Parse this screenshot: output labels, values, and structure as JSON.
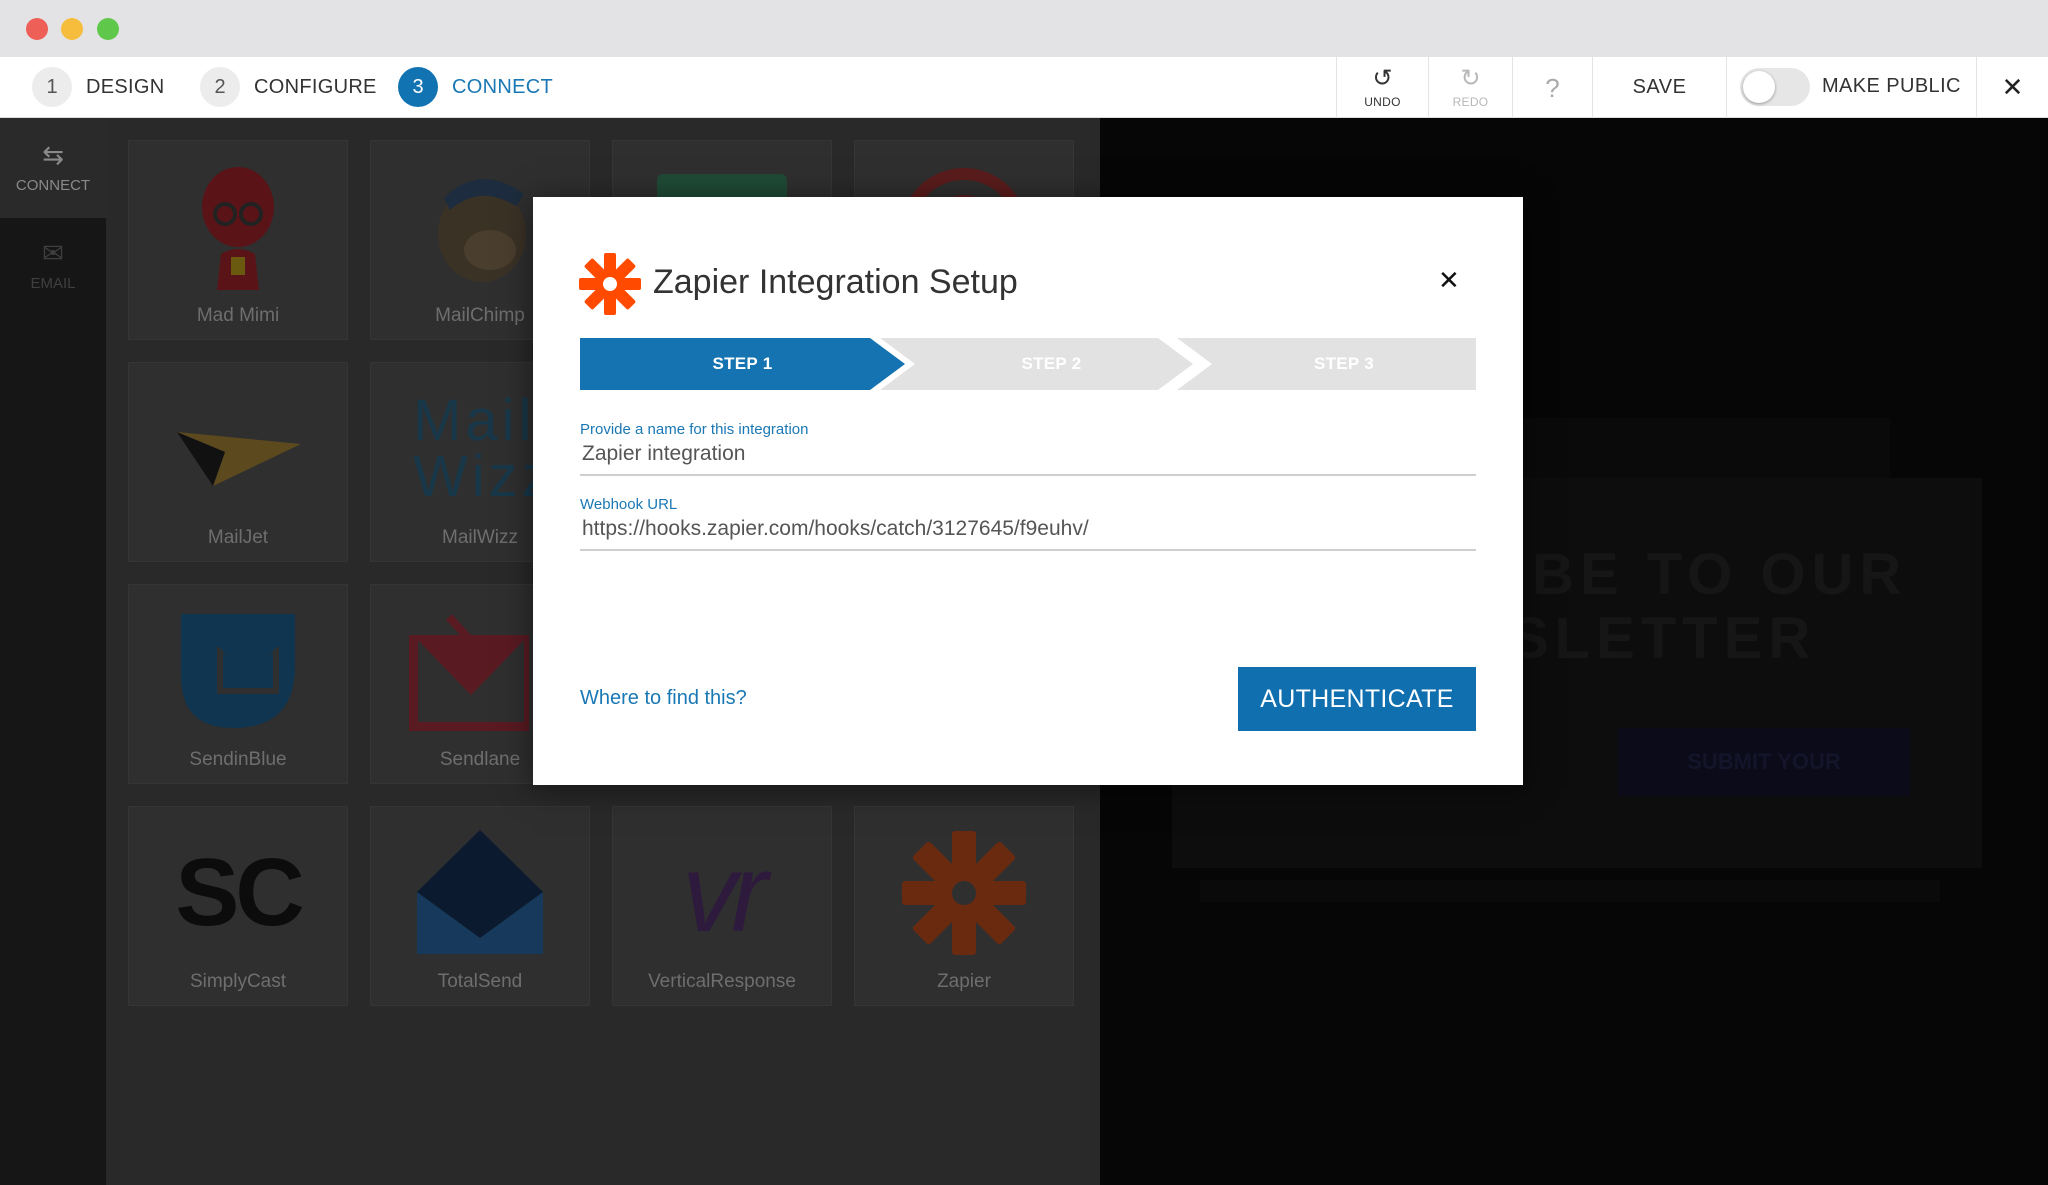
{
  "toolbar": {
    "steps": [
      {
        "num": "1",
        "label": "DESIGN"
      },
      {
        "num": "2",
        "label": "CONFIGURE"
      },
      {
        "num": "3",
        "label": "CONNECT"
      }
    ],
    "undo_label": "UNDO",
    "redo_label": "REDO",
    "help_label": "?",
    "save_label": "SAVE",
    "make_public_label": "MAKE PUBLIC",
    "make_public_enabled": false,
    "close_symbol": "✕",
    "accent_color": "#1173b1"
  },
  "rail": {
    "items": [
      {
        "label": "CONNECT",
        "icon": "arrows-exchange-icon"
      },
      {
        "label": "EMAIL",
        "icon": "envelope-icon"
      }
    ]
  },
  "providers": [
    {
      "name": "Mad Mimi"
    },
    {
      "name": "MailChimp"
    },
    {
      "name": ""
    },
    {
      "name": ""
    },
    {
      "name": "MailJet"
    },
    {
      "name": "MailWizz",
      "logo_text": "Mail Wizz"
    },
    {
      "name": "SendinBlue"
    },
    {
      "name": "Sendlane"
    },
    {
      "name": "SimplyCast",
      "logo_text": "SC"
    },
    {
      "name": "TotalSend"
    },
    {
      "name": "VerticalResponse",
      "logo_text": "vr"
    },
    {
      "name": "Zapier"
    }
  ],
  "preview": {
    "headline_line1": "IBE TO OUR",
    "headline_line2": "SLETTER",
    "button_text": "SUBMIT YOUR"
  },
  "modal": {
    "title": "Zapier Integration Setup",
    "close_symbol": "✕",
    "steps": [
      "STEP 1",
      "STEP 2",
      "STEP 3"
    ],
    "active_step": 1,
    "fields": {
      "name": {
        "label": "Provide a name for this integration",
        "value": "Zapier integration"
      },
      "webhook": {
        "label": "Webhook URL",
        "value": "https://hooks.zapier.com/hooks/catch/3127645/f9euhv/"
      }
    },
    "help_link": "Where to find this?",
    "authenticate_label": "AUTHENTICATE",
    "brand_color": "#ff4a00"
  }
}
